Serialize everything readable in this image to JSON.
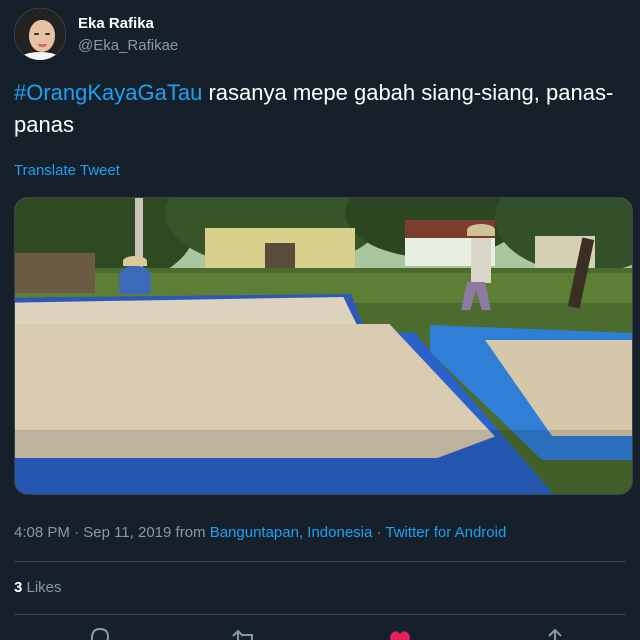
{
  "author": {
    "display_name": "Eka Rafika",
    "handle": "@Eka_Rafikae"
  },
  "tweet": {
    "hashtag": "#OrangKayaGaTau",
    "text": " rasanya mepe gabah siang-siang, panas-panas",
    "translate_label": "Translate Tweet"
  },
  "meta": {
    "time": "4:08 PM",
    "sep1": " · ",
    "date": "Sep 11, 2019",
    "from_label": " from ",
    "location": "Banguntapan, Indonesia",
    "sep2": " · ",
    "client": "Twitter for Android"
  },
  "stats": {
    "likes_count": "3",
    "likes_label": " Likes"
  },
  "actions": [
    {
      "icon": "reply-icon"
    },
    {
      "icon": "retweet-icon"
    },
    {
      "icon": "like-icon",
      "color": "#e0245e"
    },
    {
      "icon": "share-icon"
    }
  ],
  "colors": {
    "background": "#15202b",
    "link": "#1da1f2",
    "secondary_text": "#8899a6",
    "like": "#e0245e"
  }
}
